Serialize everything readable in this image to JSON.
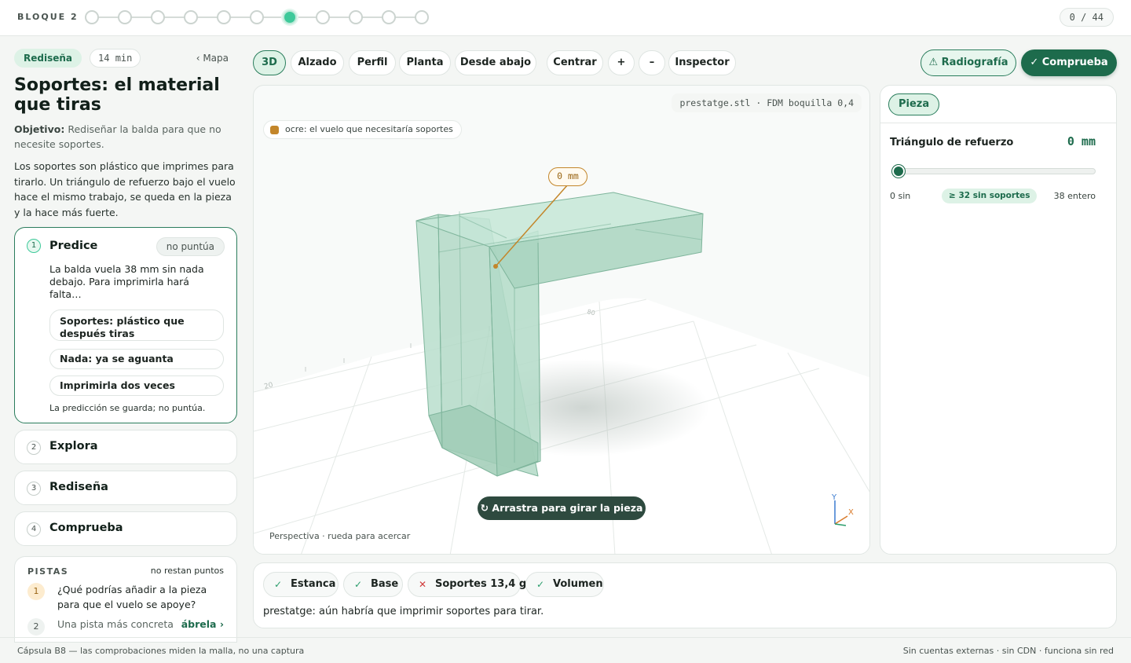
{
  "topbar": {
    "block_label": "BLOQUE 2",
    "step_count": 11,
    "active_step": 7,
    "counter": "0 / 44"
  },
  "left": {
    "tag": "Rediseña",
    "time": "14 min",
    "map_link": "‹ Mapa",
    "title": "Soportes: el material que tiras",
    "objective_label": "Objetivo:",
    "objective_text": "Rediseñar la balda para que no necesite soportes.",
    "intro": "Los soportes son plástico que imprimes para tirarlo. Un triángulo de refuerzo bajo el vuelo hace el mismo trabajo, se queda en la pieza y la hace más fuerte."
  },
  "predict": {
    "num": "1",
    "title": "Predice",
    "badge": "no puntúa",
    "question": "La balda vuela 38 mm sin nada debajo. Para imprimirla hará falta…",
    "options": [
      "Soportes: plástico que después tiras",
      "Nada: ya se aguanta",
      "Imprimirla dos veces"
    ],
    "note": "La predicción se guarda; no puntúa."
  },
  "steps": [
    {
      "num": "2",
      "title": "Explora"
    },
    {
      "num": "3",
      "title": "Rediseña"
    },
    {
      "num": "4",
      "title": "Comprueba"
    }
  ],
  "hints": {
    "title": "PISTAS",
    "remaining": "no restan puntos",
    "items": [
      {
        "num": "1",
        "text": "¿Qué podrías añadir a la pieza para que el vuelo se apoye?"
      },
      {
        "num": "2",
        "text": "Una pista más concreta",
        "action": "ábrela ›"
      }
    ]
  },
  "toolbar": {
    "views": [
      "3D",
      "Alzado",
      "Perfil",
      "Planta",
      "Desde abajo",
      "Centrar",
      "+",
      "–",
      "Inspector"
    ],
    "active_view": "3D",
    "xray": "Radiografía",
    "check": "Comprueba"
  },
  "viewport": {
    "file": "prestatge.stl · FDM boquilla 0,4",
    "legend": "ocre: el vuelo que necesitaría soportes",
    "measure": "0 mm",
    "grid_labels": [
      "20",
      "80"
    ],
    "drag_hint": "Arrastra para girar la pieza",
    "perspective": "Perspectiva · rueda para acercar",
    "axis_y": "Y",
    "axis_x": "X",
    "colors": {
      "part": "#a9d6c0",
      "overhang": "#c3862a"
    }
  },
  "inspector": {
    "tab": "Pieza",
    "param_label": "Triángulo de refuerzo",
    "param_value": "0 mm",
    "slider": {
      "min": 0,
      "max": 38,
      "value": 0
    },
    "min_label": "0 sin",
    "mid_label": "≥ 32 sin soportes",
    "max_label": "38 entero"
  },
  "checks": {
    "items": [
      {
        "label": "Estanca",
        "status": "ok"
      },
      {
        "label": "Base",
        "status": "ok"
      },
      {
        "label": "Soportes 13,4 g",
        "status": "fail"
      },
      {
        "label": "Volumen",
        "status": "ok"
      }
    ],
    "message": "prestatge: aún habría que imprimir soportes para tirar."
  },
  "footer": {
    "left": "Cápsula B8 — las comprobaciones miden la malla, no una captura",
    "right": "Sin cuentas externas · sin CDN · funciona sin red"
  }
}
